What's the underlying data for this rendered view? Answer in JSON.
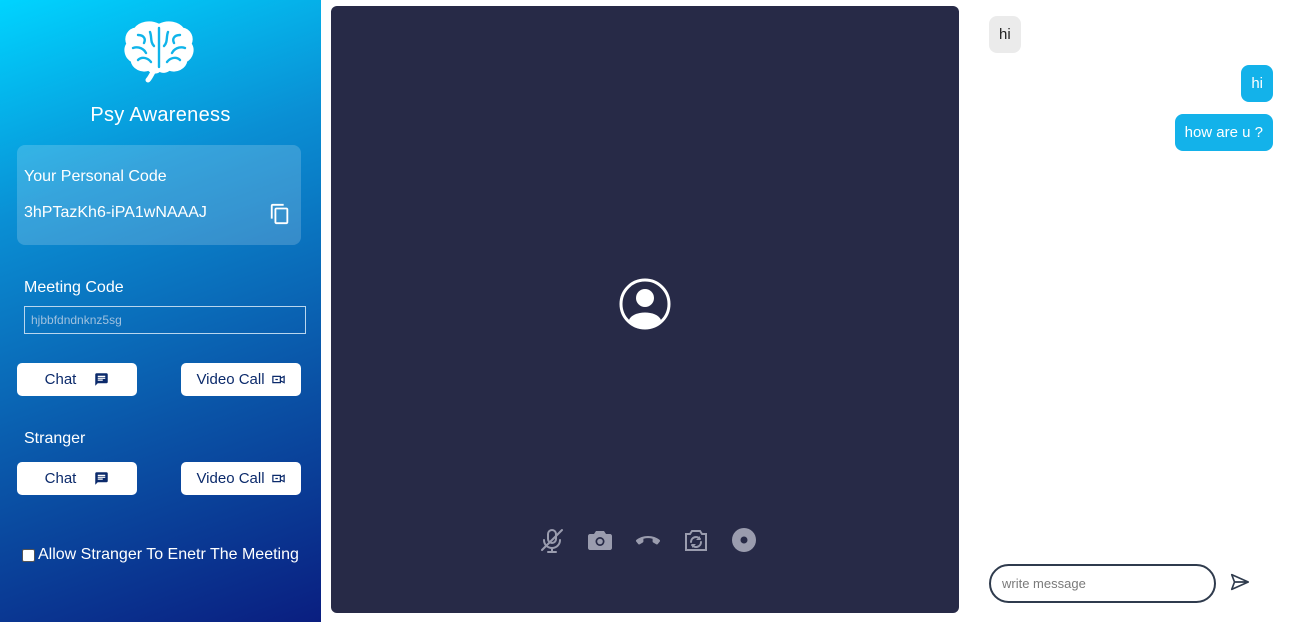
{
  "sidebar": {
    "app_name": "Psy Awareness",
    "personal_code_title": "Your Personal Code",
    "personal_code": "3hPTazKh6-iPA1wNAAAJ",
    "meeting_code_label": "Meeting Code",
    "meeting_code_value": "hjbbfdndnknz5sg",
    "meeting_chat_label": "Chat",
    "meeting_video_label": "Video Call",
    "stranger_label": "Stranger",
    "stranger_chat_label": "Chat",
    "stranger_video_label": "Video Call",
    "allow_stranger_label": "Allow Stranger To Enetr The Meeting",
    "allow_stranger_checked": false
  },
  "video": {
    "controls": [
      "mic-off-icon",
      "camera-icon",
      "hang-up-icon",
      "switch-camera-icon",
      "record-icon"
    ]
  },
  "chat": {
    "messages": [
      {
        "direction": "incoming",
        "text": "hi"
      },
      {
        "direction": "outgoing",
        "text": "hi"
      },
      {
        "direction": "outgoing",
        "text": "how are u ?"
      }
    ],
    "input_placeholder": "write message"
  },
  "colors": {
    "sidebar_top": "#00d4ff",
    "sidebar_bottom": "#0a1e80",
    "video_bg": "#272a47",
    "outgoing_bubble": "#13b2ea",
    "incoming_bubble": "#ebebeb"
  }
}
